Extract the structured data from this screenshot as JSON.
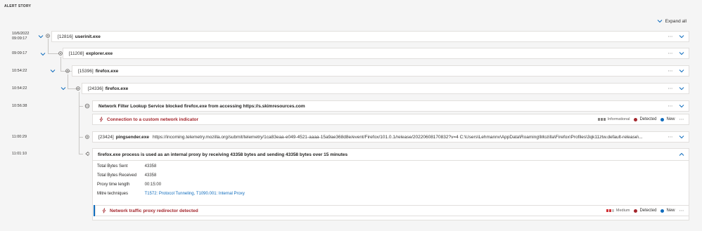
{
  "header": {
    "title": "ALERT STORY",
    "expand_all": "Expand all"
  },
  "events": [
    {
      "date": "10/6/2022",
      "time": "09:09:17",
      "pid": "[12816]",
      "name": "userinit.exe"
    },
    {
      "time": "09:09:17",
      "pid": "[11208]",
      "name": "explorer.exe"
    },
    {
      "time": "10:54:22",
      "pid": "[15396]",
      "name": "firefox.exe"
    },
    {
      "time": "10:54:22",
      "pid": "[24336]",
      "name": "firefox.exe"
    },
    {
      "time": "10:56:38",
      "text": "Network Filter Lookup Service blocked firefox.exe from accessing https://s.skimresources.com"
    },
    {
      "time": "11:00:29",
      "pid": "[23424]",
      "name": "pingsender.exe",
      "cmd": "https://incoming.telemetry.mozilla.org/submit/telemetry/1ca83eaa-e049-4521-aaaa-15a9ae368d8e/event/Firefox/101.0.1/release/20220608170832?v=4 C:\\Users\\Lehmannv\\AppData\\Roaming\\Mozilla\\Firefox\\Profiles\\3qk11ztw.default-release\\..."
    },
    {
      "time": "11:01:10",
      "text": "firefox.exe process is used as an internal proxy by receiving 43358 bytes and sending 43358 bytes over 15 minutes"
    }
  ],
  "alert1": {
    "title": "Connection to a custom network indicator",
    "severity": "Informational",
    "status": "Detected",
    "classification": "New"
  },
  "proxy_details": [
    {
      "key": "Total Bytes Sent",
      "value": "43358"
    },
    {
      "key": "Total Bytes Received",
      "value": "43358"
    },
    {
      "key": "Proxy time length",
      "value": "00:15:00"
    },
    {
      "key": "Mitre techniques",
      "value": "T1572: Protocol Tunneling, T1090.001: Internal Proxy"
    }
  ],
  "alert2": {
    "title": "Network traffic proxy redirector detected",
    "severity": "Medium",
    "status": "Detected",
    "classification": "New"
  },
  "icons": {
    "more": "⋯"
  },
  "colors": {
    "accent": "#0f6cbd",
    "alert_red": "#a4262c",
    "medium_severity": "#d13438"
  }
}
